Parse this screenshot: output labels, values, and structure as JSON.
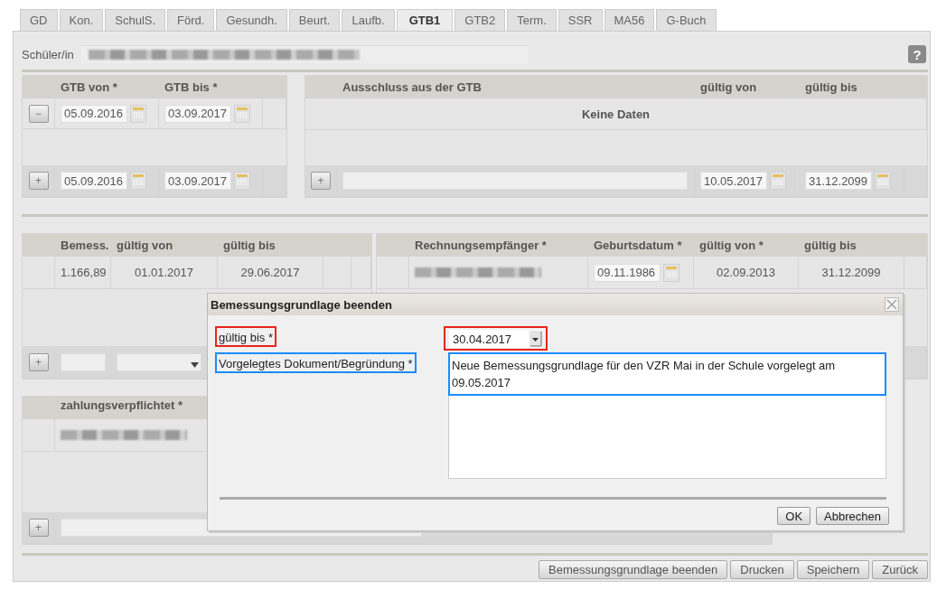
{
  "tabs": [
    {
      "label": "GD",
      "selected": false
    },
    {
      "label": "Kon.",
      "selected": false
    },
    {
      "label": "SchulS.",
      "selected": false
    },
    {
      "label": "Förd.",
      "selected": false
    },
    {
      "label": "Gesundh.",
      "selected": false
    },
    {
      "label": "Beurt.",
      "selected": false
    },
    {
      "label": "Laufb.",
      "selected": false
    },
    {
      "label": "GTB1",
      "selected": true
    },
    {
      "label": "GTB2",
      "selected": false
    },
    {
      "label": "Term.",
      "selected": false
    },
    {
      "label": "SSR",
      "selected": false
    },
    {
      "label": "MA56",
      "selected": false
    },
    {
      "label": "G-Buch",
      "selected": false
    }
  ],
  "student": {
    "label": "Schüler/in"
  },
  "help": {
    "label": "?"
  },
  "gtb_table": {
    "columns": [
      "GTB von *",
      "GTB bis *"
    ],
    "rows": [
      {
        "action": "−",
        "from": "05.09.2016",
        "to": "03.09.2017"
      }
    ],
    "new_row": {
      "action": "+",
      "from": "05.09.2016",
      "to": "03.09.2017"
    }
  },
  "exclusion_table": {
    "columns": [
      "Ausschluss aus der GTB",
      "gültig von",
      "gültig bis"
    ],
    "empty_text": "Keine Daten",
    "new_row": {
      "action": "+",
      "from": "10.05.2017",
      "to": "31.12.2099"
    }
  },
  "assessment_table": {
    "columns": [
      "Bemess.",
      "gültig von",
      "gültig bis"
    ],
    "rows": [
      {
        "cells": [
          "1.166,89",
          "01.01.2017",
          "29.06.2017"
        ]
      }
    ],
    "new_row": {
      "action": "+"
    }
  },
  "recipient_table": {
    "columns": [
      "Rechnungsempfänger *",
      "Geburtsdatum *",
      "gültig von *",
      "gültig bis"
    ],
    "rows": [
      {
        "birth_date": "09.11.1986",
        "from": "02.09.2013",
        "to": "31.12.2099"
      }
    ]
  },
  "payer_table": {
    "columns": [
      "zahlungsverpflichtet *"
    ],
    "new_row": {
      "action": "+"
    }
  },
  "dialog": {
    "title": "Bemessungsgrundlage beenden",
    "fields": [
      {
        "kind": "date-select",
        "label": "gültig bis *",
        "value": "30.04.2017",
        "color": "#e8251b"
      },
      {
        "kind": "textarea",
        "label": "Vorgelegtes Dokument/Begründung *",
        "value": "Neue Bemessungsgrundlage für den VZR Mai in der Schule vorgelegt am 09.05.2017",
        "color": "#1a8cff"
      }
    ],
    "buttons": [
      "OK",
      "Abbrechen"
    ]
  },
  "actions": [
    "Bemessungsgrundlage beenden",
    "Drucken",
    "Speichern",
    "Zurück"
  ]
}
